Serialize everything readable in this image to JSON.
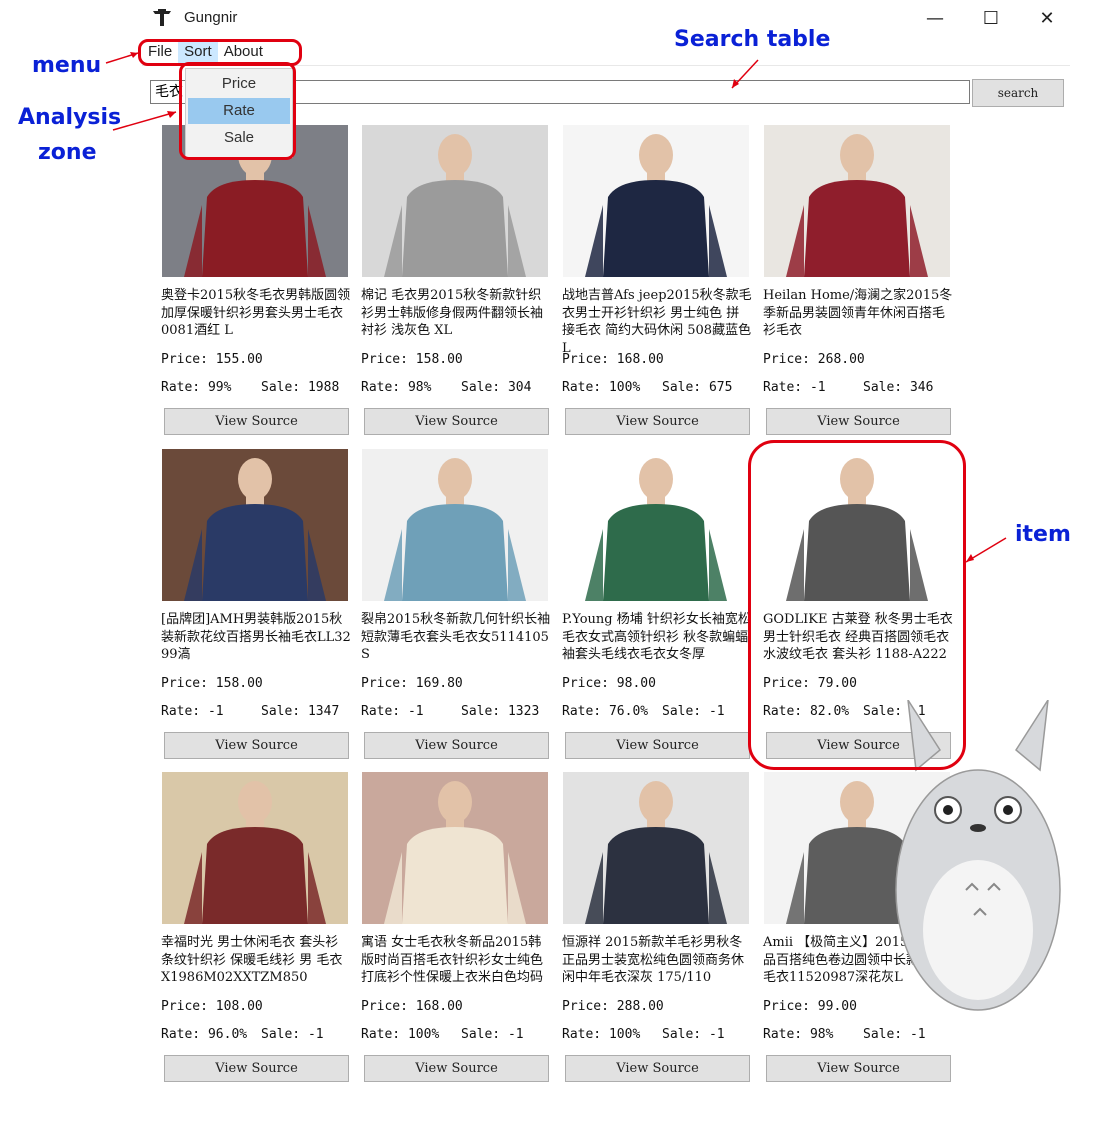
{
  "window": {
    "title": "Gungnir",
    "minimize_glyph": "—",
    "maximize_glyph": "☐",
    "close_glyph": "✕"
  },
  "menu": {
    "items": [
      {
        "label": "File"
      },
      {
        "label": "Sort"
      },
      {
        "label": "About"
      }
    ],
    "sort_options": [
      "Price",
      "Rate",
      "Sale"
    ],
    "selected_sort": "Rate"
  },
  "search": {
    "value": "毛衣",
    "button_label": "search"
  },
  "annotations": {
    "menu": "menu",
    "search_table": "Search table",
    "analysis_line1": "Analysis",
    "analysis_line2": "zone",
    "item": "item"
  },
  "view_source_label": "View Source",
  "items": [
    {
      "title": "奥登卡2015秋冬毛衣男韩版圆领加厚保暖针织衫男套头男士毛衣 0081酒红 L",
      "price": "Price: 155.00",
      "rate": "Rate: 99%",
      "sale": "Sale: 1988",
      "color": "#8a1c24",
      "bg": "#7d7f86"
    },
    {
      "title": "棉记 毛衣男2015秋冬新款针织衫男士韩版修身假两件翻领长袖衬衫 浅灰色 XL",
      "price": "Price: 158.00",
      "rate": "Rate: 98%",
      "sale": "Sale: 304",
      "color": "#9b9b9b",
      "bg": "#d8d8d8"
    },
    {
      "title": "战地吉普Afs jeep2015秋冬款毛衣男士开衫针织衫 男士纯色 拼接毛衣 简约大码休闲 508藏蓝色 L",
      "price": "Price: 168.00",
      "rate": "Rate: 100%",
      "sale": "Sale: 675",
      "color": "#1e2742",
      "bg": "#f5f5f5"
    },
    {
      "title": "Heilan Home/海澜之家2015冬季新品男装圆领青年休闲百搭毛衫毛衣",
      "price": "Price: 268.00",
      "rate": "Rate: -1",
      "sale": "Sale: 346",
      "color": "#8f1e2c",
      "bg": "#e9e6e1"
    },
    {
      "title": "[品牌团]AMH男装韩版2015秋装新款花纹百搭男长袖毛衣LL3299滈",
      "price": "Price: 158.00",
      "rate": "Rate: -1",
      "sale": "Sale: 1347",
      "color": "#2a3a66",
      "bg": "#6b4a3a"
    },
    {
      "title": "裂帛2015秋冬新款几何针织长袖短款薄毛衣套头毛衣女5114105S",
      "price": "Price: 169.80",
      "rate": "Rate: -1",
      "sale": "Sale: 1323",
      "color": "#6fa0b8",
      "bg": "#f0f0f0"
    },
    {
      "title": "P.Young 杨埔 针织衫女长袖宽松毛衣女式高领针织衫 秋冬款蝙蝠袖套头毛线衣毛衣女冬厚",
      "price": "Price: 98.00",
      "rate": "Rate: 76.0%",
      "sale": "Sale: -1",
      "color": "#2e6b4b",
      "bg": "#ffffff"
    },
    {
      "title": "GODLIKE 古莱登 秋冬男士毛衣 男士针织毛衣 经典百搭圆领毛衣 水波纹毛衣 套头衫 1188-A222",
      "price": "Price: 79.00",
      "rate": "Rate: 82.0%",
      "sale": "Sale: -1",
      "color": "#555555",
      "bg": "#ffffff"
    },
    {
      "title": "幸福时光 男士休闲毛衣 套头衫 条纹针织衫 保暖毛线衫 男 毛衣 X1986M02XXTZM850",
      "price": "Price: 108.00",
      "rate": "Rate: 96.0%",
      "sale": "Sale: -1",
      "color": "#7a2a2a",
      "bg": "#d9c8a8"
    },
    {
      "title": "寓语 女士毛衣秋冬新品2015韩版时尚百搭毛衣针织衫女士纯色打底衫个性保暖上衣米白色均码",
      "price": "Price: 168.00",
      "rate": "Rate: 100%",
      "sale": "Sale: -1",
      "color": "#efe4d2",
      "bg": "#c9a89c"
    },
    {
      "title": "恒源祥 2015新款羊毛衫男秋冬 正品男士装宽松纯色圆领商务休闲中年毛衣深灰 175/110",
      "price": "Price: 288.00",
      "rate": "Rate: 100%",
      "sale": "Sale: -1",
      "color": "#2c3140",
      "bg": "#e2e2e2"
    },
    {
      "title": "Amii 【极简主义】2015秋冬新品百搭纯色卷边圆领中长款混纺毛衣11520987深花灰L",
      "price": "Price: 99.00",
      "rate": "Rate: 98%",
      "sale": "Sale: -1",
      "color": "#5d5d5d",
      "bg": "#f3f3f3"
    }
  ]
}
